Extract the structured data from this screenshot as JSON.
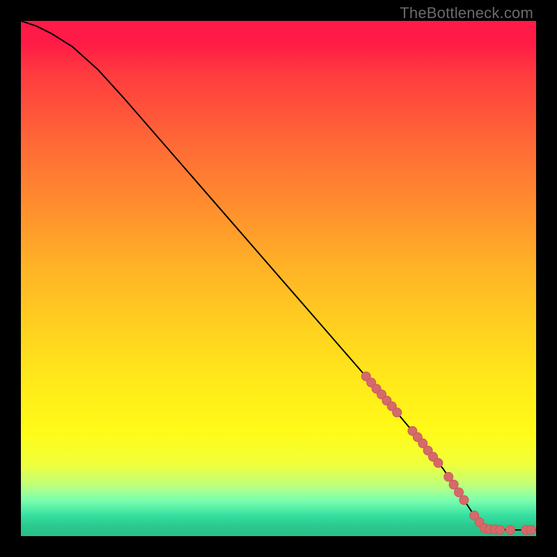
{
  "watermark": "TheBottleneck.com",
  "colors": {
    "line": "#000000",
    "marker": "#d46a6a",
    "marker_stroke": "#c95858"
  },
  "chart_data": {
    "type": "line",
    "title": "",
    "xlabel": "",
    "ylabel": "",
    "xlim": [
      0,
      100
    ],
    "ylim": [
      0,
      100
    ],
    "grid": false,
    "legend": false,
    "series": [
      {
        "name": "curve",
        "x": [
          0,
          3,
          6,
          10,
          15,
          20,
          30,
          40,
          50,
          60,
          70,
          78,
          82,
          85,
          88,
          90,
          95,
          100
        ],
        "y": [
          100,
          99,
          97.5,
          95,
          90.5,
          85,
          73.5,
          62,
          50.5,
          39,
          27.5,
          18,
          13,
          8.5,
          4,
          1.5,
          1.2,
          1.2
        ]
      }
    ],
    "markers": [
      {
        "x": 67.0,
        "y": 31.0
      },
      {
        "x": 68.0,
        "y": 29.8
      },
      {
        "x": 69.0,
        "y": 28.6
      },
      {
        "x": 70.0,
        "y": 27.5
      },
      {
        "x": 71.0,
        "y": 26.3
      },
      {
        "x": 72.0,
        "y": 25.2
      },
      {
        "x": 73.0,
        "y": 24.0
      },
      {
        "x": 76.0,
        "y": 20.4
      },
      {
        "x": 77.0,
        "y": 19.2
      },
      {
        "x": 78.0,
        "y": 18.0
      },
      {
        "x": 79.0,
        "y": 16.6
      },
      {
        "x": 80.0,
        "y": 15.4
      },
      {
        "x": 81.0,
        "y": 14.2
      },
      {
        "x": 83.0,
        "y": 11.5
      },
      {
        "x": 84.0,
        "y": 10.0
      },
      {
        "x": 85.0,
        "y": 8.5
      },
      {
        "x": 86.0,
        "y": 7.0
      },
      {
        "x": 88.0,
        "y": 4.0
      },
      {
        "x": 89.0,
        "y": 2.7
      },
      {
        "x": 90.0,
        "y": 1.5
      },
      {
        "x": 91.0,
        "y": 1.3
      },
      {
        "x": 92.0,
        "y": 1.3
      },
      {
        "x": 93.0,
        "y": 1.2
      },
      {
        "x": 95.0,
        "y": 1.2
      },
      {
        "x": 98.0,
        "y": 1.2
      },
      {
        "x": 99.0,
        "y": 1.2
      }
    ]
  }
}
